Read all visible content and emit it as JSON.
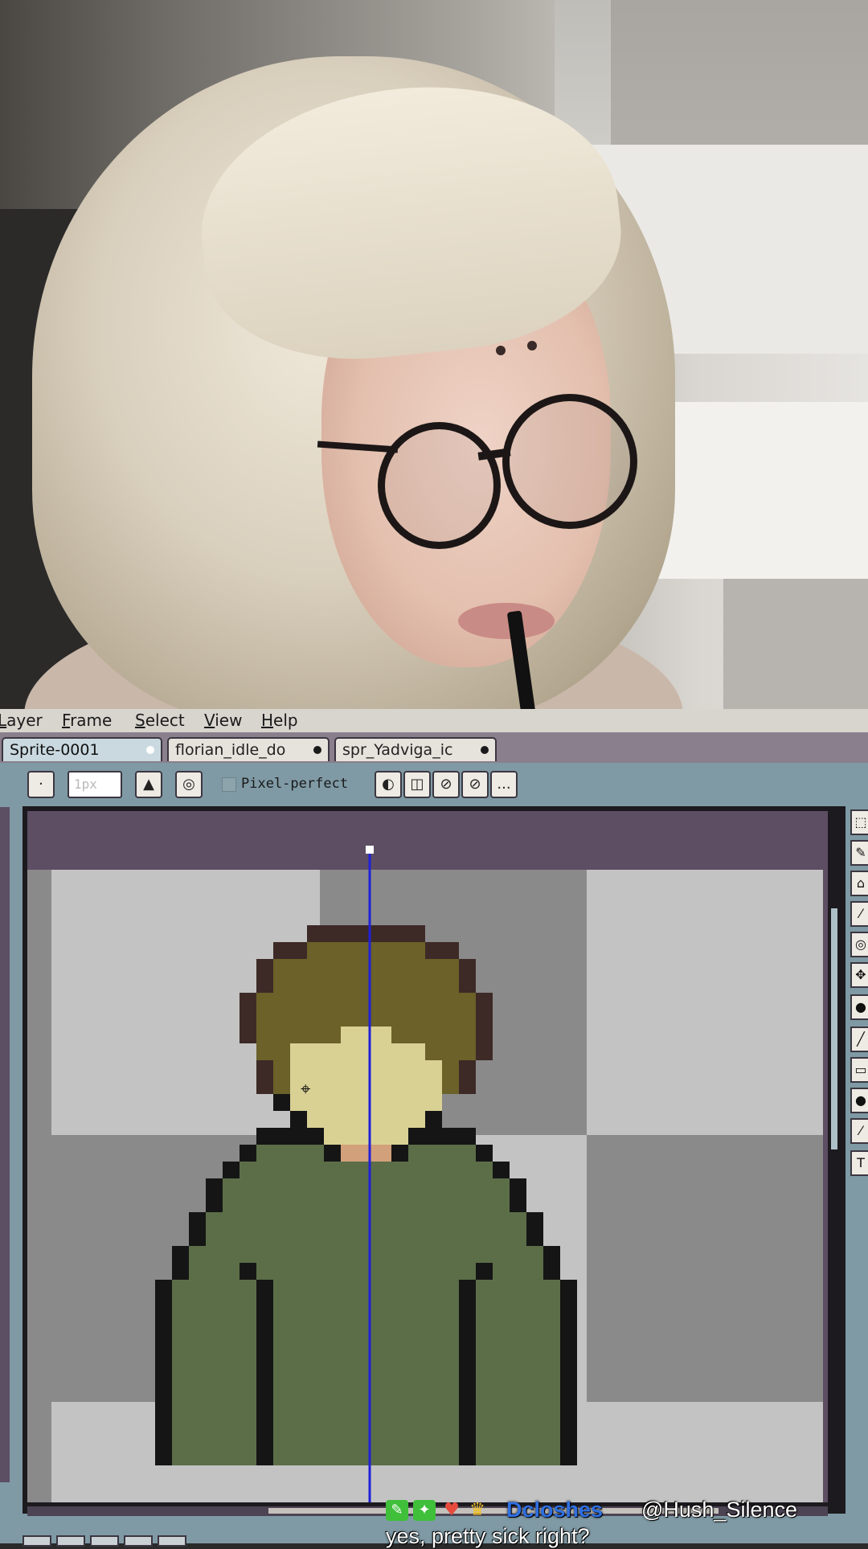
{
  "menu": {
    "items": [
      "Layer",
      "Frame",
      "Select",
      "View",
      "Help"
    ]
  },
  "tabs": [
    {
      "label": "Sprite-0001",
      "active": true
    },
    {
      "label": "florian_idle_do",
      "active": false
    },
    {
      "label": "spr_Yadviga_ic",
      "active": false
    }
  ],
  "toolbar": {
    "brush_size_placeholder": "1px",
    "pixel_perfect_label": "Pixel-perfect",
    "more_label": "..."
  },
  "tools": [
    "marquee",
    "pencil",
    "eraser",
    "eyedropper",
    "zoom",
    "move",
    "fill",
    "line",
    "rectangle",
    "ellipse",
    "blur",
    "text"
  ],
  "chat": {
    "username": "Dcloshes",
    "mention": "@Hush_Silence",
    "message": "yes, pretty sick right?"
  },
  "colors": {
    "ui_panel": "#7f9aa5",
    "menubar": "#d8d5cf",
    "canvas_background": "#5d4e63",
    "checker_light": "#c3c3c3",
    "checker_dark": "#8a8a8a",
    "hair_dark": "#3d2a26",
    "hair": "#6b6129",
    "skin": "#d9d194",
    "neck": "#d2a07a",
    "shirt": "#5c6e48",
    "outline": "#151515",
    "symmetry_line": "#2020d8",
    "chat_username": "#2f6fe0"
  }
}
